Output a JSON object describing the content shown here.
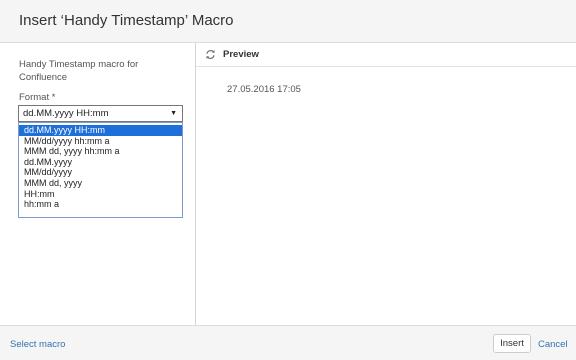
{
  "dialog": {
    "title": "Insert ‘Handy Timestamp’ Macro"
  },
  "left_panel": {
    "description": "Handy Timestamp macro for Confluence",
    "format_label": "Format *",
    "format_selected": "dd.MM.yyyy HH:mm",
    "format_options": [
      "dd.MM.yyyy HH:mm",
      "MM/dd/yyyy hh:mm a",
      "MMM dd, yyyy hh:mm a",
      "dd.MM.yyyy",
      "MM/dd/yyyy",
      "MMM dd, yyyy",
      "HH:mm",
      "hh:mm a"
    ]
  },
  "preview": {
    "label": "Preview",
    "icon": "refresh-icon",
    "content": "27.05.2016 17:05"
  },
  "footer": {
    "select_macro_label": "Select macro",
    "insert_label": "Insert",
    "cancel_label": "Cancel"
  },
  "colors": {
    "accent": "#3572b0",
    "selection": "#1e6fd9",
    "header_bg": "#f5f5f5"
  }
}
